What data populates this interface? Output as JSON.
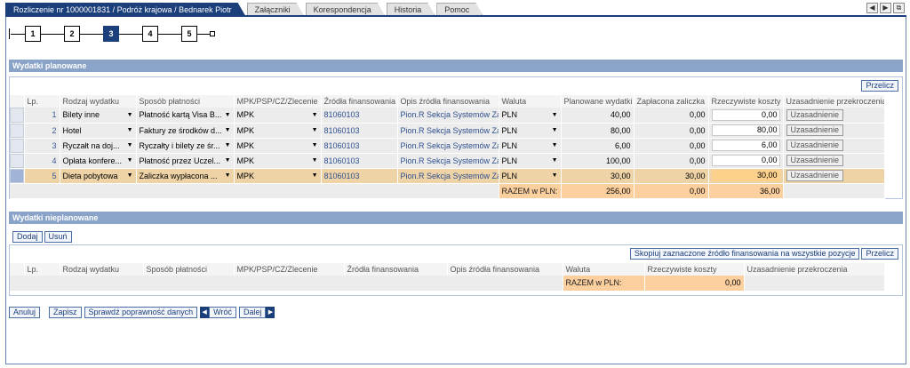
{
  "tabs": [
    {
      "label": "Rozliczenie nr 1000001831 / Podróż krajowa / Bednarek Piotr",
      "active": true
    },
    {
      "label": "Załączniki",
      "active": false
    },
    {
      "label": "Korespondencja",
      "active": false
    },
    {
      "label": "Historia",
      "active": false
    },
    {
      "label": "Pomoc",
      "active": false
    }
  ],
  "nav": {
    "prev": "◀",
    "next": "▶",
    "window": "⧉"
  },
  "roadmap": {
    "steps": [
      "1",
      "2",
      "3",
      "4",
      "5"
    ],
    "active_index": 2
  },
  "planned": {
    "title": "Wydatki planowane",
    "refresh_label": "Przelicz",
    "columns": [
      "Lp.",
      "Rodzaj wydatku",
      "Sposób płatności",
      "MPK/PSP/CZ/Zlecenie",
      "Źródła finansowania",
      "Opis źródła finansowania",
      "Waluta",
      "Planowane wydatki",
      "Zapłacona zaliczka",
      "Rzeczywiste koszty",
      "Uzasadnienie przekroczenia"
    ],
    "rows": [
      {
        "lp": "1",
        "type": "Bilety inne",
        "payment": "Płatność kartą Visa B...",
        "mpk": "MPK",
        "source": "81060103",
        "source_desc": "Pion.R Sekcja Systemów Zar",
        "currency": "PLN",
        "planned": "40,00",
        "advance": "0,00",
        "actual": "0,00",
        "justify": "Uzasadnienie",
        "selected": false
      },
      {
        "lp": "2",
        "type": "Hotel",
        "payment": "Faktury ze środków d...",
        "mpk": "MPK",
        "source": "81060103",
        "source_desc": "Pion.R Sekcja Systemów Zar",
        "currency": "PLN",
        "planned": "80,00",
        "advance": "0,00",
        "actual": "80,00",
        "justify": "Uzasadnienie",
        "selected": false
      },
      {
        "lp": "3",
        "type": "Ryczałt na doj...",
        "payment": "Ryczałty i bilety ze śr...",
        "mpk": "MPK",
        "source": "81060103",
        "source_desc": "Pion.R Sekcja Systemów Zar",
        "currency": "PLN",
        "planned": "6,00",
        "advance": "0,00",
        "actual": "6,00",
        "justify": "Uzasadnienie",
        "selected": false
      },
      {
        "lp": "4",
        "type": "Opłata konfere...",
        "payment": "Płatność przez Uczel...",
        "mpk": "MPK",
        "source": "81060103",
        "source_desc": "Pion.R Sekcja Systemów Zar",
        "currency": "PLN",
        "planned": "100,00",
        "advance": "0,00",
        "actual": "0,00",
        "justify": "Uzasadnienie",
        "selected": false
      },
      {
        "lp": "5",
        "type": "Dieta pobytowa",
        "payment": "Zaliczka wypłacona ...",
        "mpk": "MPK",
        "source": "81060103",
        "source_desc": "Pion.R Sekcja Systemów Zar",
        "currency": "PLN",
        "planned": "30,00",
        "advance": "30,00",
        "actual": "30,00",
        "justify": "Uzasadnienie",
        "selected": true
      }
    ],
    "total_label": "RAZEM w PLN:",
    "total_planned": "256,00",
    "total_advance": "0,00",
    "total_actual": "36,00"
  },
  "unplanned": {
    "title": "Wydatki nieplanowane",
    "add_label": "Dodaj",
    "remove_label": "Usuń",
    "copy_label": "Skopiuj zaznaczone źródło finansowania na wszystkie pozycje",
    "refresh_label": "Przelicz",
    "columns": [
      "Lp.",
      "Rodzaj wydatku",
      "Sposób płatności",
      "MPK/PSP/CZ/Zlecenie",
      "Źródła finansowania",
      "Opis źródła finansowania",
      "Waluta",
      "Rzeczywiste koszty",
      "Uzasadnienie przekroczenia"
    ],
    "total_label": "RAZEM w PLN:",
    "total_actual": "0,00"
  },
  "actions": {
    "cancel": "Anuluj",
    "save": "Zapisz",
    "validate": "Sprawdź poprawność danych",
    "back": "Wróć",
    "next": "Dalej"
  }
}
